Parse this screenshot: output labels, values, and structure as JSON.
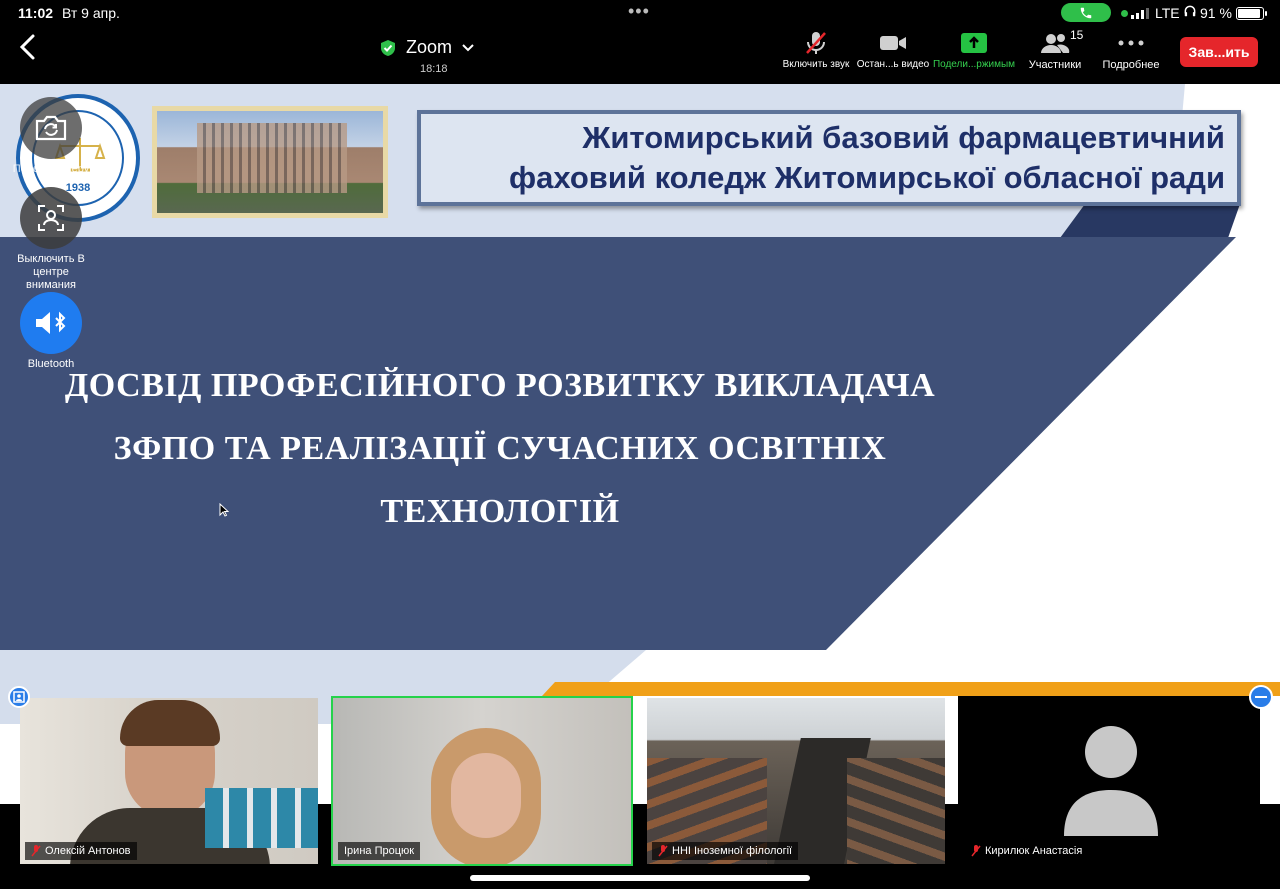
{
  "status": {
    "time": "11:02",
    "date": "Вт 9 апр.",
    "network": "LTE",
    "battery": "91 %",
    "battery_level": 0.91
  },
  "header": {
    "app_name": "Zoom",
    "timer": "18:18"
  },
  "toolbar": [
    {
      "id": "mic",
      "label": "Включить звук",
      "icon": "mic-off-icon"
    },
    {
      "id": "video",
      "label": "Остан...ь видео",
      "icon": "video-camera-icon"
    },
    {
      "id": "share",
      "label": "Подели...ржимым",
      "icon": "share-screen-icon"
    },
    {
      "id": "participants",
      "label": "Участники",
      "icon": "participants-icon",
      "count": "15"
    },
    {
      "id": "more",
      "label": "Подробнее",
      "icon": "more-dots-icon"
    }
  ],
  "end_button": "Зав...ить",
  "slide": {
    "org_line1": "Житомирський базовий фармацевтичний",
    "org_line2": "фаховий коледж Житомирської обласної ради",
    "title_line1": "ДОСВІД ПРОФЕСІЙНОГО РОЗВИТКУ ВИКЛАДАЧА",
    "title_line2": "ЗФПО ТА РЕАЛІЗАЦІЇ СУЧАСНИХ ОСВІТНІХ",
    "title_line3": "ТЕХНОЛОГІЙ",
    "logo_year": "1938",
    "colors": {
      "navy": "#3f5078",
      "title_text": "#1e2f68",
      "accent": "#f0a018"
    }
  },
  "side_controls": {
    "camera_label": "Перек...камеру",
    "spotlight_label": "Выключить В центре внимания",
    "audio_label": "Bluetooth"
  },
  "participants": [
    {
      "name": "Олексій Антонов",
      "muted": true
    },
    {
      "name": "Ірина Процюк",
      "muted": false,
      "active": true
    },
    {
      "name": "ННІ Іноземної філології",
      "muted": true
    },
    {
      "name": "Кирилюк Анастасія",
      "muted": true
    }
  ]
}
